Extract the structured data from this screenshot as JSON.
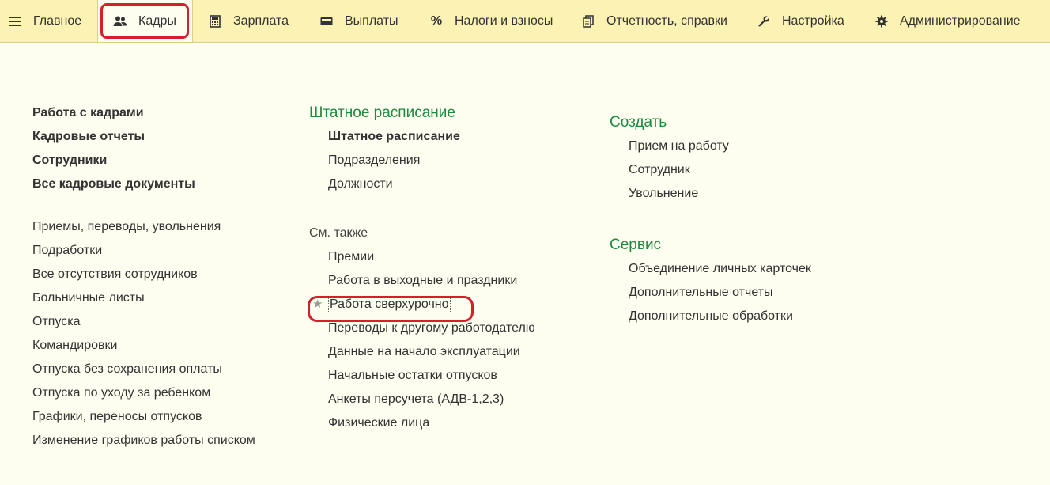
{
  "menu": {
    "main": "Главное",
    "staff": "Кадры",
    "salary": "Зарплата",
    "payments": "Выплаты",
    "taxes": "Налоги и взносы",
    "reports": "Отчетность, справки",
    "settings": "Настройка",
    "admin": "Администрирование"
  },
  "icons": {
    "main": "hamburger-menu",
    "staff": "people",
    "salary": "calculator",
    "payments": "wallet",
    "taxes": "percent",
    "reports": "documents",
    "settings": "wrench",
    "admin": "gear"
  },
  "left_bold": [
    "Работа с кадрами",
    "Кадровые отчеты",
    "Сотрудники",
    "Все кадровые документы"
  ],
  "left_list": [
    "Приемы, переводы, увольнения",
    "Подработки",
    "Все отсутствия сотрудников",
    "Больничные листы",
    "Отпуска",
    "Командировки",
    "Отпуска без сохранения оплаты",
    "Отпуска по уходу за ребенком",
    "Графики, переносы отпусков",
    "Изменение графиков работы списком"
  ],
  "staffing": {
    "heading": "Штатное расписание",
    "items": [
      "Штатное расписание",
      "Подразделения",
      "Должности"
    ]
  },
  "see_also": {
    "heading": "См. также",
    "items": [
      "Премии",
      "Работа в выходные и праздники",
      "Работа сверхурочно",
      "Переводы к другому работодателю",
      "Данные на начало эксплуатации",
      "Начальные остатки отпусков",
      "Анкеты персучета (АДВ-1,2,3)",
      "Физические лица"
    ]
  },
  "create": {
    "heading": "Создать",
    "items": [
      "Прием на работу",
      "Сотрудник",
      "Увольнение"
    ]
  },
  "service": {
    "heading": "Сервис",
    "items": [
      "Объединение личных карточек",
      "Дополнительные отчеты",
      "Дополнительные обработки"
    ]
  },
  "colors": {
    "topbar": "#fbf2b3",
    "background": "#fefef0",
    "heading": "#1e8a3e",
    "highlight": "#d4202a"
  }
}
